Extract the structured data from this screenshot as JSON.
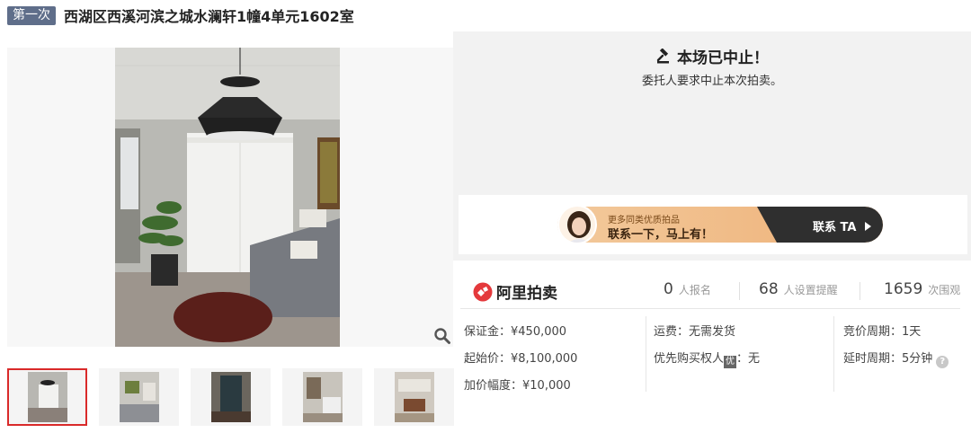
{
  "title": {
    "badge": "第一次",
    "text": "西湖区西溪河滨之城水澜轩1幢4单元1602室"
  },
  "gallery": {
    "zoom_icon": "magnifier-icon",
    "thumbnails": [
      "thumb-1",
      "thumb-2",
      "thumb-3",
      "thumb-4",
      "thumb-5"
    ],
    "active_index": 0
  },
  "status": {
    "icon": "gavel-icon",
    "title": "本场已中止！",
    "subtitle": "委托人要求中止本次拍卖。"
  },
  "banner": {
    "line1": "更多同类优质拍品",
    "line2": "联系一下，马上有！",
    "cta": "联系 TA",
    "cta_icon": "play-triangle-icon"
  },
  "brand": {
    "name": "阿里拍卖",
    "logo": "ali-auction-logo"
  },
  "stats": [
    {
      "value": "0",
      "label": "人报名"
    },
    {
      "value": "68",
      "label": "人设置提醒"
    },
    {
      "value": "1659",
      "label": "次围观"
    }
  ],
  "details": {
    "col1": [
      "保证金：¥450,000",
      "起始价：¥8,100,000",
      "加价幅度：¥10,000"
    ],
    "col2": [
      "运费：无需发货",
      "优先购买权人",
      "：无"
    ],
    "col2_tag": "优",
    "col3": [
      "竞价周期：1天",
      "延时周期：5分钟"
    ],
    "help_icon": "?"
  },
  "colors": {
    "badge_bg": "#5f6e8a",
    "active_thumb_border": "#d92a2a",
    "brand_red": "#e4393c",
    "banner_orange": "#efb178",
    "banner_dark": "#2f2f2f"
  }
}
